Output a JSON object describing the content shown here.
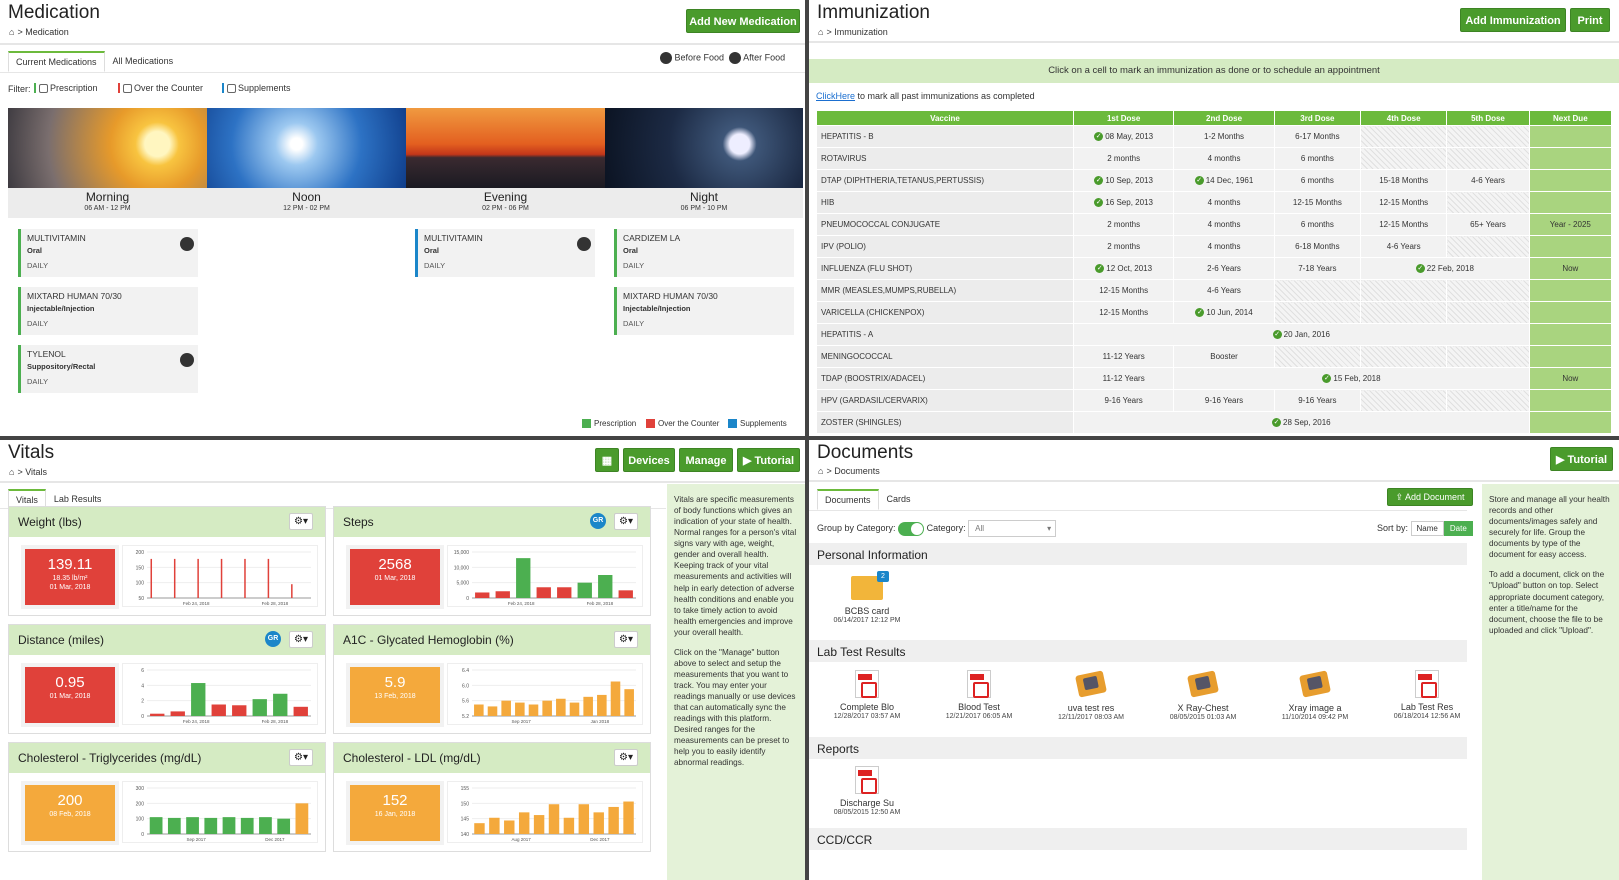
{
  "medication": {
    "title": "Medication",
    "crumb": "Medication",
    "add_btn": "Add New Medication",
    "tabs": [
      "Current Medications",
      "All Medications"
    ],
    "before_food": "Before Food",
    "after_food": "After Food",
    "filter_label": "Filter:",
    "filters": [
      "Prescription",
      "Over the Counter",
      "Supplements"
    ],
    "slots": [
      {
        "name": "Morning",
        "time": "06 AM - 12 PM"
      },
      {
        "name": "Noon",
        "time": "12 PM - 02 PM"
      },
      {
        "name": "Evening",
        "time": "02 PM - 06 PM"
      },
      {
        "name": "Night",
        "time": "06 PM - 10 PM"
      }
    ],
    "cards": [
      {
        "name": "MULTIVITAMIN",
        "route": "Oral",
        "freq": "DAILY"
      },
      {
        "name": "MIXTARD HUMAN 70/30",
        "route": "Injectable/Injection",
        "freq": "DAILY"
      },
      {
        "name": "TYLENOL",
        "route": "Suppository/Rectal",
        "freq": "DAILY"
      },
      {
        "name": "MULTIVITAMIN",
        "route": "Oral",
        "freq": "DAILY"
      },
      {
        "name": "CARDIZEM LA",
        "route": "Oral",
        "freq": "DAILY"
      },
      {
        "name": "MIXTARD HUMAN 70/30",
        "route": "Injectable/Injection",
        "freq": "DAILY"
      }
    ],
    "legend": [
      "Prescription",
      "Over the Counter",
      "Supplements"
    ],
    "colors": {
      "prescription": "#4caf50",
      "otc": "#e0413a",
      "supplements": "#1b86c9"
    }
  },
  "immunization": {
    "title": "Immunization",
    "crumb": "Immunization",
    "add_btn": "Add Immunization",
    "print_btn": "Print",
    "banner": "Click on a cell to mark an immunization as done or to schedule an appointment",
    "clickhere": "ClickHere",
    "clickhere_rest": " to mark all past immunizations as completed",
    "headers": [
      "Vaccine",
      "1st Dose",
      "2nd Dose",
      "3rd Dose",
      "4th Dose",
      "5th Dose",
      "Next Due"
    ],
    "rows": [
      [
        "HEPATITIS - B",
        "✓08 May, 2013",
        "1-2 Months",
        "6-17 Months",
        "#",
        "#",
        ""
      ],
      [
        "ROTAVIRUS",
        "2 months",
        "4 months",
        "6 months",
        "#",
        "#",
        ""
      ],
      [
        "DTAP (DIPHTHERIA,TETANUS,PERTUSSIS)",
        "✓10 Sep, 2013",
        "✓14 Dec, 1961",
        "6 months",
        "15-18 Months",
        "4-6 Years",
        ""
      ],
      [
        "HIB",
        "✓16 Sep, 2013",
        "4 months",
        "12-15 Months",
        "12-15 Months",
        "#",
        ""
      ],
      [
        "PNEUMOCOCCAL CONJUGATE",
        "2 months",
        "4 months",
        "6 months",
        "12-15 Months",
        "65+ Years",
        "Year - 2025"
      ],
      [
        "IPV (POLIO)",
        "2 months",
        "4 months",
        "6-18 Months",
        "4-6 Years",
        "#",
        ""
      ],
      [
        "INFLUENZA (FLU SHOT)",
        "✓12 Oct, 2013",
        "2-6 Years",
        "7-18 Years",
        "✓22 Feb, 2018",
        "",
        "Now"
      ],
      [
        "MMR (MEASLES,MUMPS,RUBELLA)",
        "12-15 Months",
        "4-6 Years",
        "#",
        "#",
        "#",
        ""
      ],
      [
        "VARICELLA (CHICKENPOX)",
        "12-15 Months",
        "✓10 Jun, 2014",
        "#",
        "#",
        "#",
        ""
      ],
      [
        "HEPATITIS - A",
        "✓20 Jan, 2016",
        "",
        "",
        "",
        "",
        ""
      ],
      [
        "MENINGOCOCCAL",
        "11-12 Years",
        "Booster",
        "#",
        "#",
        "#",
        ""
      ],
      [
        "TDAP (BOOSTRIX/ADACEL)",
        "11-12 Years",
        "✓15 Feb, 2018",
        "",
        "",
        "",
        "Now"
      ],
      [
        "HPV (GARDASIL/CERVARIX)",
        "9-16 Years",
        "9-16 Years",
        "9-16 Years",
        "#",
        "#",
        ""
      ],
      [
        "ZOSTER (SHINGLES)",
        "✓28 Sep, 2016",
        "",
        "",
        "",
        "",
        ""
      ]
    ]
  },
  "vitals": {
    "title": "Vitals",
    "crumb": "Vitals",
    "btn_devices": "Devices",
    "btn_manage": "Manage",
    "btn_tutorial": "▶ Tutorial",
    "tabs": [
      "Vitals",
      "Lab Results"
    ],
    "cards": [
      {
        "title": "Weight (lbs)",
        "value": "139.11",
        "sub": "18.35 lb/m²",
        "date": "01 Mar, 2018",
        "color": "#e0413a",
        "gr": ""
      },
      {
        "title": "Steps",
        "value": "2568",
        "sub": "",
        "date": "01 Mar, 2018",
        "color": "#e0413a",
        "gr": "GR"
      },
      {
        "title": "Distance (miles)",
        "value": "0.95",
        "sub": "",
        "date": "01 Mar, 2018",
        "color": "#e0413a",
        "gr": "GR"
      },
      {
        "title": "A1C - Glycated Hemoglobin (%)",
        "value": "5.9",
        "sub": "",
        "date": "13 Feb, 2018",
        "color": "#f4a93c",
        "gr": ""
      },
      {
        "title": "Cholesterol - Triglycerides (mg/dL)",
        "value": "200",
        "sub": "",
        "date": "08 Feb, 2018",
        "color": "#f4a93c",
        "gr": ""
      },
      {
        "title": "Cholesterol - LDL (mg/dL)",
        "value": "152",
        "sub": "",
        "date": "16 Jan, 2018",
        "color": "#f4a93c",
        "gr": ""
      }
    ],
    "chart_data": [
      {
        "type": "bar",
        "yticks": [
          "200",
          "150",
          "100",
          "50"
        ],
        "xticks": [
          "Feb 24, 2018",
          "Feb 28, 2018"
        ],
        "values": [
          170,
          170,
          170,
          170,
          170,
          170,
          60
        ],
        "colors": [
          "r",
          "r",
          "r",
          "r",
          "r",
          "r",
          "r"
        ],
        "ymax": 200
      },
      {
        "type": "bar",
        "yticks": [
          "15,000",
          "10,000",
          "5,000",
          "0"
        ],
        "xticks": [
          "Feb 24, 2018",
          "Feb 28, 2018"
        ],
        "values": [
          1800,
          2200,
          13000,
          3500,
          3500,
          5000,
          7500,
          2500
        ],
        "colors": [
          "r",
          "r",
          "g",
          "r",
          "r",
          "g",
          "g",
          "r"
        ],
        "ymax": 15000
      },
      {
        "type": "bar",
        "yticks": [
          "6",
          "4",
          "2",
          "0"
        ],
        "xticks": [
          "Feb 24, 2018",
          "Feb 28, 2018"
        ],
        "values": [
          0.3,
          0.6,
          4.3,
          1.5,
          1.4,
          2.2,
          2.9,
          1.2
        ],
        "colors": [
          "r",
          "r",
          "g",
          "r",
          "r",
          "g",
          "g",
          "r"
        ],
        "ymax": 6
      },
      {
        "type": "bar",
        "yticks": [
          "6.4",
          "6.0",
          "5.6",
          "5.2"
        ],
        "xticks": [
          "Sep 2017",
          "Jan 2018"
        ],
        "values": [
          5.5,
          5.45,
          5.6,
          5.55,
          5.5,
          5.6,
          5.65,
          5.55,
          5.7,
          5.75,
          6.1,
          5.9
        ],
        "colors": [
          "o",
          "o",
          "o",
          "o",
          "o",
          "o",
          "o",
          "o",
          "o",
          "o",
          "o",
          "o"
        ],
        "ymin": 5.2,
        "ymax": 6.4
      },
      {
        "type": "bar",
        "yticks": [
          "300",
          "200",
          "100",
          "0"
        ],
        "xticks": [
          "Sep 2017",
          "Dec 2017"
        ],
        "values": [
          110,
          105,
          110,
          105,
          110,
          105,
          110,
          100,
          200
        ],
        "colors": [
          "g",
          "g",
          "g",
          "g",
          "g",
          "g",
          "g",
          "g",
          "o"
        ],
        "ymax": 300
      },
      {
        "type": "bar",
        "yticks": [
          "155",
          "150",
          "145",
          "140"
        ],
        "xticks": [
          "Aug 2017",
          "Dec 2017"
        ],
        "values": [
          144,
          146,
          145,
          148,
          147,
          151,
          146,
          151,
          148,
          150,
          152
        ],
        "colors": [
          "o",
          "o",
          "o",
          "o",
          "o",
          "o",
          "o",
          "o",
          "o",
          "o",
          "o"
        ],
        "ymin": 140,
        "ymax": 157
      }
    ],
    "side": [
      "Vitals are specific measurements of body functions which gives an indication of your state of health. Normal ranges for a person's vital signs vary with age, weight, gender and overall health. Keeping track of your vital measurements and activities will help in early detection of adverse health conditions and enable you to take timely action to avoid health emergencies and improve your overall health.",
      "Click on the \"Manage\" button above to select and setup the measurements that you want to track. You may enter your readings manually or use devices that can automatically sync the readings with this platform. Desired ranges for the measurements can be preset to help you to easily identify abnormal readings."
    ]
  },
  "documents": {
    "title": "Documents",
    "crumb": "Documents",
    "btn_tutorial": "▶ Tutorial",
    "tabs": [
      "Documents",
      "Cards"
    ],
    "add_btn": "Add Document",
    "group_label": "Group by Category:",
    "category_label": "Category:",
    "category_value": "All",
    "sort_label": "Sort by:",
    "sort_name": "Name",
    "sort_date": "Date",
    "sections": [
      "Personal Information",
      "Lab Test Results",
      "Reports",
      "CCD/CCR"
    ],
    "personal": [
      {
        "name": "BCBS card",
        "date": "06/14/2017 12:12 PM",
        "badge": "2"
      }
    ],
    "lab": [
      {
        "name": "Complete Blo",
        "date": "12/28/2017 03:57 AM",
        "kind": "pdf"
      },
      {
        "name": "Blood Test",
        "date": "12/21/2017 06:05 AM",
        "kind": "pdf"
      },
      {
        "name": "uva test res",
        "date": "12/11/2017 08:03 AM",
        "kind": "img"
      },
      {
        "name": "X Ray-Chest",
        "date": "08/05/2015 01:03 AM",
        "kind": "img"
      },
      {
        "name": "Xray image a",
        "date": "11/10/2014 09:42 PM",
        "kind": "img"
      },
      {
        "name": "Lab Test Res",
        "date": "06/18/2014 12:56 AM",
        "kind": "pdf"
      }
    ],
    "reports": [
      {
        "name": "Discharge Su",
        "date": "08/05/2015 12:50 AM"
      }
    ],
    "side": [
      "Store and manage all your health records and other documents/images safely and securely for life. Group the documents by type of the document for easy access.",
      "To add a document, click on the \"Upload\" button on top. Select appropriate document category, enter a title/name for the document, choose the file to be uploaded and click \"Upload\"."
    ]
  }
}
